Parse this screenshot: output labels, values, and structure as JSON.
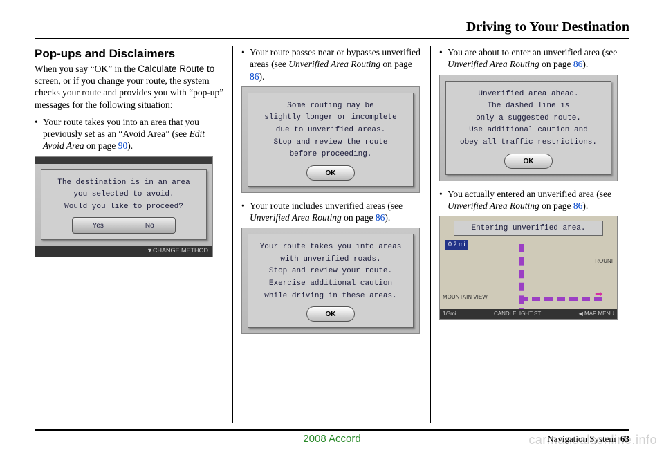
{
  "header": {
    "title": "Driving to Your Destination"
  },
  "col1": {
    "heading": "Pop-ups and Disclaimers",
    "intro_a": "When you say “OK” in the ",
    "intro_b": "Calculate Route to",
    "intro_c": " screen, or if you change your route, the system checks your route and provides you with “pop-up” messages for the following situation:",
    "b1_a": "Your route takes you into an area that you previously set as an “Avoid Area” (see ",
    "b1_ital": "Edit Avoid Area",
    "b1_b": " on page ",
    "b1_page": "90",
    "b1_c": ").",
    "ss1_l1": "The destination is in an area",
    "ss1_l2": "you selected to avoid.",
    "ss1_l3": "Would you like to proceed?",
    "yes": "Yes",
    "no": "No",
    "change": "▼CHANGE METHOD"
  },
  "col2": {
    "b1_a": "Your route passes near or bypasses unverified areas (see ",
    "b1_ital": "Unverified Area Routing",
    "b1_b": " on page ",
    "b1_page": "86",
    "b1_c": ").",
    "ss1_l1": "Some routing may be",
    "ss1_l2": "slightly longer or incomplete",
    "ss1_l3": "due to unverified areas.",
    "ss1_l4": "Stop and review the route",
    "ss1_l5": "before proceeding.",
    "ok": "OK",
    "b2_a": "Your route includes unverified areas (see ",
    "b2_ital": "Unverified Area Routing",
    "b2_b": " on page ",
    "b2_page": "86",
    "b2_c": ").",
    "ss2_l1": "Your route takes you into areas",
    "ss2_l2": "with unverified roads.",
    "ss2_l3": "Stop and review your route.",
    "ss2_l4": "Exercise additional caution",
    "ss2_l5": "while driving in these areas."
  },
  "col3": {
    "b1_a": "You are about to enter an unverified area (see ",
    "b1_ital": "Unverified Area Routing",
    "b1_b": " on page ",
    "b1_page": "86",
    "b1_c": ").",
    "ss1_l1": "Unverified area ahead.",
    "ss1_l2": "The dashed line is",
    "ss1_l3": "only a suggested route.",
    "ss1_l4": "Use additional caution and",
    "ss1_l5": "obey all traffic restrictions.",
    "ok": "OK",
    "b2_a": "You actually entered an unverified area (see ",
    "b2_ital": "Unverified Area Routing",
    "b2_b": " on page ",
    "b2_page": "86",
    "b2_c": ").",
    "map_banner": "Entering unverified area.",
    "map_dist": "0.2 mi",
    "map_loc": "MOUNTAIN VIEW",
    "map_rouni": "ROUNI",
    "map_scale": "1/8mi",
    "map_street": "CANDLELIGHT ST",
    "map_menu": "◀ MAP MENU"
  },
  "footer": {
    "model": "2008   Accord",
    "navsys": "Navigation System",
    "page": "63",
    "watermark": "carmanualsonline.info"
  }
}
